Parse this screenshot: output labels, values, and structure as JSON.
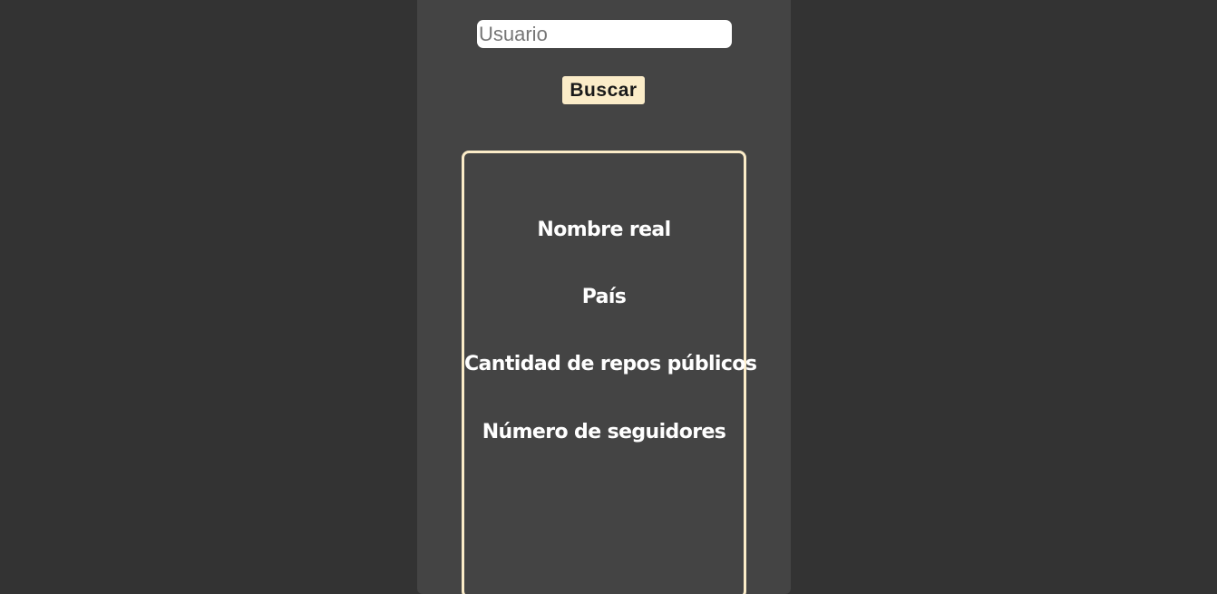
{
  "search": {
    "placeholder": "Usuario",
    "value": "",
    "button_label": "Buscar"
  },
  "result": {
    "fields": [
      {
        "label": "Nombre real"
      },
      {
        "label": "País"
      },
      {
        "label": "Cantidad de repos públicos"
      },
      {
        "label": "Número de seguidores"
      }
    ]
  },
  "colors": {
    "background": "#333333",
    "panel": "#444444",
    "accent": "#fbecc8",
    "text": "#ffffff"
  }
}
